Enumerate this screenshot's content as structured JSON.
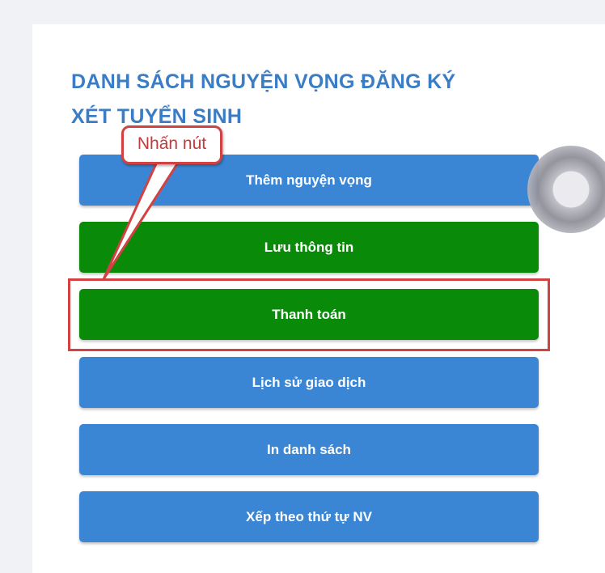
{
  "panel": {
    "title_line1": "DANH SÁCH NGUYỆN VỌNG ĐĂNG KÝ",
    "title_line2": "XÉT TUYỂN SINH"
  },
  "buttons": [
    {
      "label": "Thêm nguyện vọng",
      "color": "#3b86d4"
    },
    {
      "label": "Lưu thông tin",
      "color": "#098a09"
    },
    {
      "label": "Thanh toán",
      "color": "#098a09"
    },
    {
      "label": "Lịch sử giao dịch",
      "color": "#3b86d4"
    },
    {
      "label": "In danh sách",
      "color": "#3b86d4"
    },
    {
      "label": "Xếp theo thứ tự NV",
      "color": "#3b86d4"
    }
  ],
  "annotation": {
    "callout_text": "Nhấn nút",
    "color": "#d24242"
  },
  "icons": {
    "loading": "loading-spinner-icon"
  }
}
